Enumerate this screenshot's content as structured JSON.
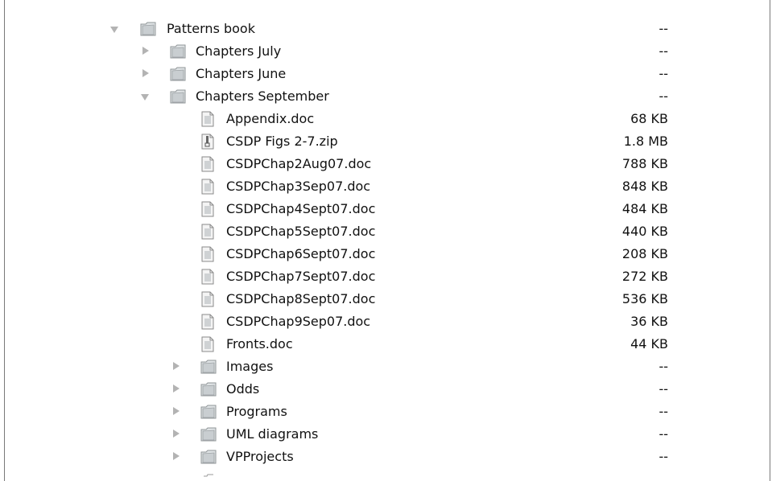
{
  "rows": [
    {
      "name": "Patterns book",
      "size": "--",
      "kind": "folder",
      "expanded": true
    },
    {
      "name": "Chapters July",
      "size": "--",
      "kind": "folder",
      "expanded": false
    },
    {
      "name": "Chapters June",
      "size": "--",
      "kind": "folder",
      "expanded": false
    },
    {
      "name": "Chapters September",
      "size": "--",
      "kind": "folder",
      "expanded": true
    },
    {
      "name": "Appendix.doc",
      "size": "68 KB",
      "kind": "doc"
    },
    {
      "name": "CSDP Figs 2-7.zip",
      "size": "1.8 MB",
      "kind": "zip"
    },
    {
      "name": "CSDPChap2Aug07.doc",
      "size": "788 KB",
      "kind": "doc"
    },
    {
      "name": "CSDPChap3Sep07.doc",
      "size": "848 KB",
      "kind": "doc"
    },
    {
      "name": "CSDPChap4Sept07.doc",
      "size": "484 KB",
      "kind": "doc"
    },
    {
      "name": "CSDPChap5Sept07.doc",
      "size": "440 KB",
      "kind": "doc"
    },
    {
      "name": "CSDPChap6Sept07.doc",
      "size": "208 KB",
      "kind": "doc"
    },
    {
      "name": "CSDPChap7Sept07.doc",
      "size": "272 KB",
      "kind": "doc"
    },
    {
      "name": "CSDPChap8Sept07.doc",
      "size": "536 KB",
      "kind": "doc"
    },
    {
      "name": "CSDPChap9Sep07.doc",
      "size": "36 KB",
      "kind": "doc"
    },
    {
      "name": "Fronts.doc",
      "size": "44 KB",
      "kind": "doc"
    },
    {
      "name": "Images",
      "size": "--",
      "kind": "folder",
      "expanded": false
    },
    {
      "name": "Odds",
      "size": "--",
      "kind": "folder",
      "expanded": false
    },
    {
      "name": "Programs",
      "size": "--",
      "kind": "folder",
      "expanded": false
    },
    {
      "name": "UML diagrams",
      "size": "--",
      "kind": "folder",
      "expanded": false
    },
    {
      "name": "VPProjects",
      "size": "--",
      "kind": "folder",
      "expanded": false
    }
  ],
  "colors": {
    "folder": "#d7dcde",
    "triangle": "#b3b3b3",
    "border": "#7a7a7a"
  }
}
